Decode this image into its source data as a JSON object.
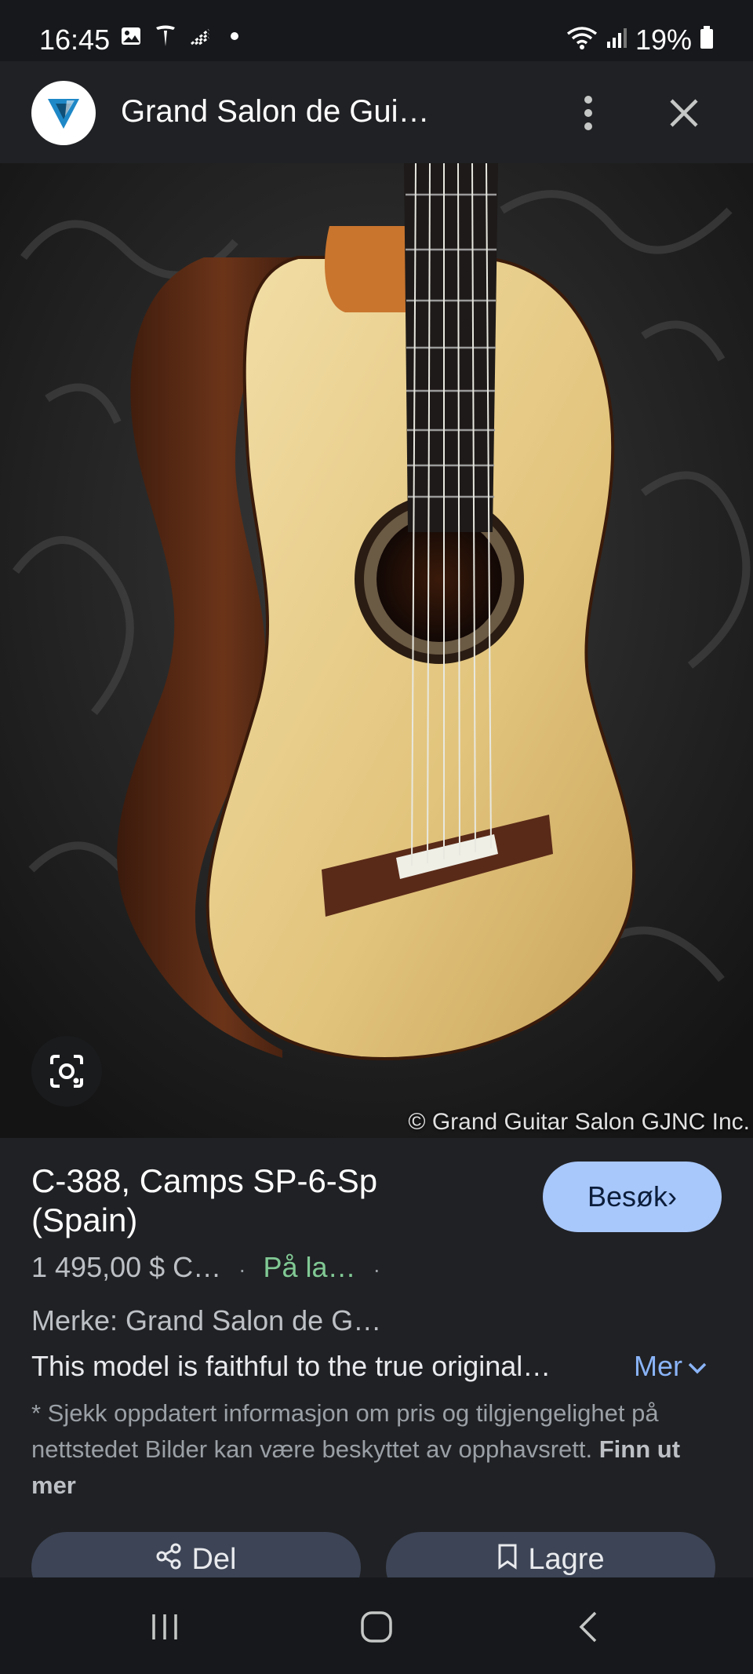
{
  "status_bar": {
    "time": "16:45",
    "battery": "19%",
    "icons": [
      "gallery-icon",
      "tesla-icon",
      "signal-strength-icon",
      "dot-icon",
      "wifi-icon",
      "cellular-icon",
      "battery-icon"
    ]
  },
  "header": {
    "site_title": "Grand Salon de Gui…",
    "logo": "site-logo-icon",
    "more_icon": "more-vert-icon",
    "close_icon": "close-icon"
  },
  "image": {
    "copyright": "© Grand Guitar Salon GJNC Inc.",
    "lens_icon": "google-lens-icon"
  },
  "product": {
    "title": "C-388, Camps SP-6-Sp (Spain)",
    "visit_label": "Besøk›",
    "price": "1 495,00 $ C…",
    "separator": "·",
    "stock": "På la…",
    "brand": "Merke: Grand Salon de G…",
    "description": "This model is faithful to the true original…",
    "more_label": "Mer",
    "disclaimer": "* Sjekk oppdatert informasjon om pris og tilgjengelighet på nettstedet Bilder kan være beskyttet av opphavsrett.",
    "learn_more": "Finn ut mer"
  },
  "actions": {
    "share_label": "Del",
    "save_label": "Lagre"
  },
  "colors": {
    "background": "#202124",
    "accent": "#a8c7fa",
    "link": "#8ab4f8",
    "in_stock": "#81c995"
  }
}
